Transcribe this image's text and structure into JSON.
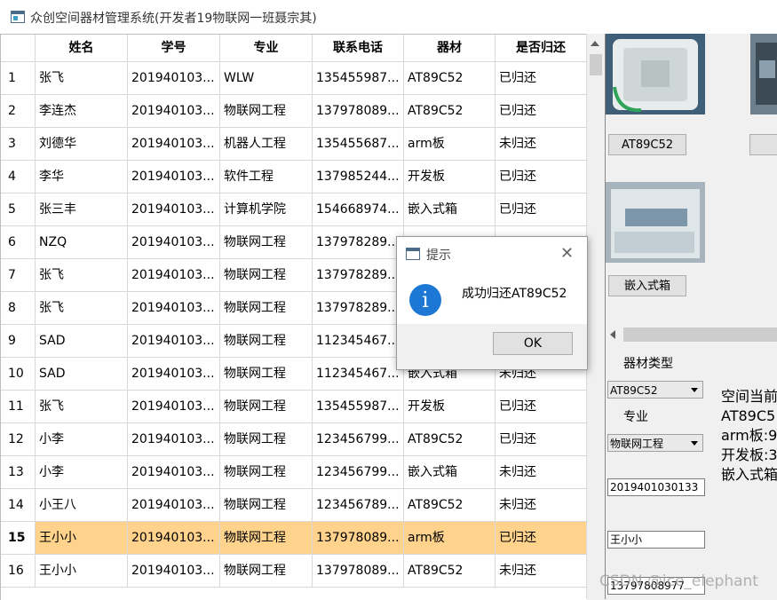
{
  "window": {
    "title": "众创空间器材管理系统(开发者19物联网一班聂宗其)"
  },
  "table": {
    "columns": [
      "姓名",
      "学号",
      "专业",
      "联系电话",
      "器材",
      "是否归还"
    ],
    "rows": [
      {
        "num": "1",
        "cells": [
          "张飞",
          "201940103...",
          "WLW",
          "135455987...",
          "AT89C52",
          "已归还"
        ]
      },
      {
        "num": "2",
        "cells": [
          "李连杰",
          "201940103...",
          "物联网工程",
          "137978089...",
          "AT89C52",
          "已归还"
        ]
      },
      {
        "num": "3",
        "cells": [
          "刘德华",
          "201940103...",
          "机器人工程",
          "135455687...",
          "arm板",
          "未归还"
        ]
      },
      {
        "num": "4",
        "cells": [
          "李华",
          "201940103...",
          "软件工程",
          "137985244...",
          "开发板",
          "已归还"
        ]
      },
      {
        "num": "5",
        "cells": [
          "张三丰",
          "201940103...",
          "计算机学院",
          "154668974...",
          "嵌入式箱",
          "已归还"
        ]
      },
      {
        "num": "6",
        "cells": [
          "NZQ",
          "201940103...",
          "物联网工程",
          "137978289...",
          "",
          ""
        ]
      },
      {
        "num": "7",
        "cells": [
          "张飞",
          "201940103...",
          "物联网工程",
          "137978289...",
          "",
          ""
        ]
      },
      {
        "num": "8",
        "cells": [
          "张飞",
          "201940103...",
          "物联网工程",
          "137978289...",
          "",
          ""
        ]
      },
      {
        "num": "9",
        "cells": [
          "SAD",
          "201940103...",
          "物联网工程",
          "112345467...",
          "",
          ""
        ]
      },
      {
        "num": "10",
        "cells": [
          "SAD",
          "201940103...",
          "物联网工程",
          "112345467...",
          "嵌入式箱",
          "未归还"
        ]
      },
      {
        "num": "11",
        "cells": [
          "张飞",
          "201940103...",
          "物联网工程",
          "135455987...",
          "开发板",
          "已归还"
        ]
      },
      {
        "num": "12",
        "cells": [
          "小李",
          "201940103...",
          "物联网工程",
          "123456799...",
          "AT89C52",
          "已归还"
        ]
      },
      {
        "num": "13",
        "cells": [
          "小李",
          "201940103...",
          "物联网工程",
          "123456799...",
          "嵌入式箱",
          "未归还"
        ]
      },
      {
        "num": "14",
        "cells": [
          "小王八",
          "201940103...",
          "物联网工程",
          "123456789...",
          "AT89C52",
          "未归还"
        ]
      },
      {
        "num": "15",
        "cells": [
          "王小小",
          "201940103...",
          "物联网工程",
          "137978089...",
          "arm板",
          "已归还"
        ],
        "selected": true
      },
      {
        "num": "16",
        "cells": [
          "王小小",
          "201940103...",
          "物联网工程",
          "137978089...",
          "AT89C52",
          "未归还"
        ]
      }
    ]
  },
  "equipment_panel": {
    "button_1": "AT89C52",
    "button_2": "嵌入式箱"
  },
  "form": {
    "type_label": "器材类型",
    "type_value": "AT89C52",
    "major_label": "专业",
    "major_value": "物联网工程",
    "student_id": "2019401030133",
    "name": "王小小",
    "phone": "13797808977"
  },
  "stats": {
    "line1": "空间当前",
    "line2": "AT89C5",
    "line3": "arm板:9",
    "line4": "开发板:3",
    "line5": "嵌入式箱"
  },
  "dialog": {
    "title": "提示",
    "message": "成功归还AT89C52",
    "ok_label": "OK"
  },
  "watermark": "CSDN @ice_elephant",
  "colors": {
    "selected_row": "#ffd38c",
    "info_icon": "#1c78d4"
  }
}
